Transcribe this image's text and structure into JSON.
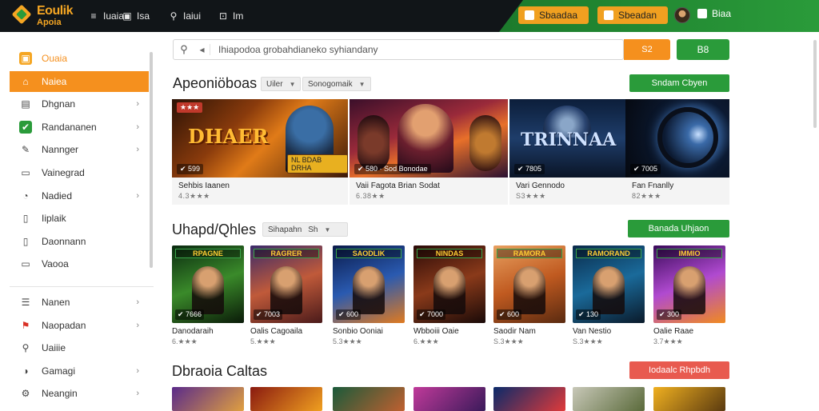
{
  "brand": {
    "title": "Eoulik",
    "subtitle": "Apoia"
  },
  "topnav": [
    {
      "icon": "menu-icon",
      "glyph": "≡",
      "label": "Iuaia"
    },
    {
      "icon": "grid-icon",
      "glyph": "▣",
      "label": "Isa"
    },
    {
      "icon": "search-icon",
      "glyph": "⚲",
      "label": "Iaiui"
    },
    {
      "icon": "controller-icon",
      "glyph": "⊡",
      "label": "Im"
    }
  ],
  "top_actions": {
    "primary_label": "Sbaadaa",
    "secondary_label": "Sbeadan",
    "user_label": "Biaa"
  },
  "search": {
    "placeholder": "Ihiapodoa grobahdianeko syhiandany",
    "button_label": "S2",
    "extra_button_label": "B8"
  },
  "sidebar": {
    "items": [
      {
        "label": "Ouaia",
        "icon": "orange-square-icon",
        "glyph": "▣",
        "chevron": false
      },
      {
        "label": "Naiea",
        "icon": "home-icon",
        "glyph": "⌂",
        "chevron": false,
        "active": true
      },
      {
        "label": "Dhgnan",
        "icon": "calendar-icon",
        "glyph": "▤",
        "chevron": true
      },
      {
        "label": "Randananen",
        "icon": "check-icon",
        "glyph": "✔",
        "chevron": true
      },
      {
        "label": "Nannger",
        "icon": "chat-icon",
        "glyph": "✎",
        "chevron": true
      },
      {
        "label": "Vainegrad",
        "icon": "window-icon",
        "glyph": "▭",
        "chevron": false
      },
      {
        "label": "Nadied",
        "icon": "clock-icon",
        "glyph": "◔",
        "chevron": true
      },
      {
        "label": "Iiplaik",
        "icon": "document-icon",
        "glyph": "▯",
        "chevron": false
      },
      {
        "label": "Daonnann",
        "icon": "page-icon",
        "glyph": "▯",
        "chevron": false
      },
      {
        "label": "Vaooa",
        "icon": "folder-icon",
        "glyph": "▭",
        "chevron": false
      }
    ],
    "bottom_items": [
      {
        "label": "Nanen",
        "icon": "list-icon",
        "glyph": "☰",
        "chevron": true
      },
      {
        "label": "Naopadan",
        "icon": "flag-icon",
        "glyph": "⚑",
        "chevron": true
      },
      {
        "label": "Uaiiie",
        "icon": "search-icon",
        "glyph": "⚲",
        "chevron": false
      },
      {
        "label": "Gamagi",
        "icon": "globe-icon",
        "glyph": "◑",
        "chevron": true
      },
      {
        "label": "Neangin",
        "icon": "gear-icon",
        "glyph": "⚙",
        "chevron": true
      }
    ]
  },
  "sections": {
    "featured": {
      "title": "Apeoniöboas",
      "filters": [
        "Uiler",
        "Sonogomaik"
      ],
      "button_label": "Sndam Cbyen",
      "cards": [
        {
          "name": "Sehbis Iaanen",
          "stars": "4.3★★★",
          "price": "✔ 599",
          "art_title": "DHAER",
          "badge": "NL BDAB DRHA"
        },
        {
          "name": "Vaii Fagota Brian Sodat",
          "stars": "6.38★★",
          "price": "✔ 580 · Sod Bonodae",
          "art_title": "",
          "badge": ""
        },
        {
          "name": "Vari Gennodo",
          "stars": "S3★★★",
          "price": "✔ 7805",
          "art_title": "TRINNAA",
          "badge": ""
        },
        {
          "name": "Fan Fnanlly",
          "stars": "82★★★",
          "price": "✔ 7005",
          "art_title": "",
          "badge": ""
        }
      ]
    },
    "updates": {
      "title": "Uhapd/Qhles",
      "filter": "Sihapahn",
      "filter_sub": "Sh",
      "button_label": "Banada Uhjaon",
      "tiles": [
        {
          "name": "Danodaraih",
          "stars": "6.★★★",
          "price": "✔ 7666",
          "art": "RPAGNE"
        },
        {
          "name": "Oalis Cagoaila",
          "stars": "5.★★★",
          "price": "✔ 7003",
          "art": "RAGRER"
        },
        {
          "name": "Sonbio Ooniai",
          "stars": "5.3★★★",
          "price": "✔ 600",
          "art": "SAODLIK"
        },
        {
          "name": "Wbboiii Oaie",
          "stars": "6.★★★",
          "price": "✔ 7000",
          "art": "NINDAS"
        },
        {
          "name": "Saodir Nam",
          "stars": "S.3★★★",
          "price": "✔ 600",
          "art": "RAMORA"
        },
        {
          "name": "Van Nestio",
          "stars": "S.3★★★",
          "price": "✔ 130",
          "art": "RAMORAND"
        },
        {
          "name": "Oalie Raae",
          "stars": "3.7★★★",
          "price": "✔ 300",
          "art": "IMMIO"
        }
      ]
    },
    "daily": {
      "title": "Dbraoia Caltas",
      "button_label": "Iodaalc Rhpbdh"
    }
  },
  "colors": {
    "accent": "#f5901e",
    "green": "#2a9b3a",
    "topbar": "#111518",
    "red": "#e85a4f"
  }
}
